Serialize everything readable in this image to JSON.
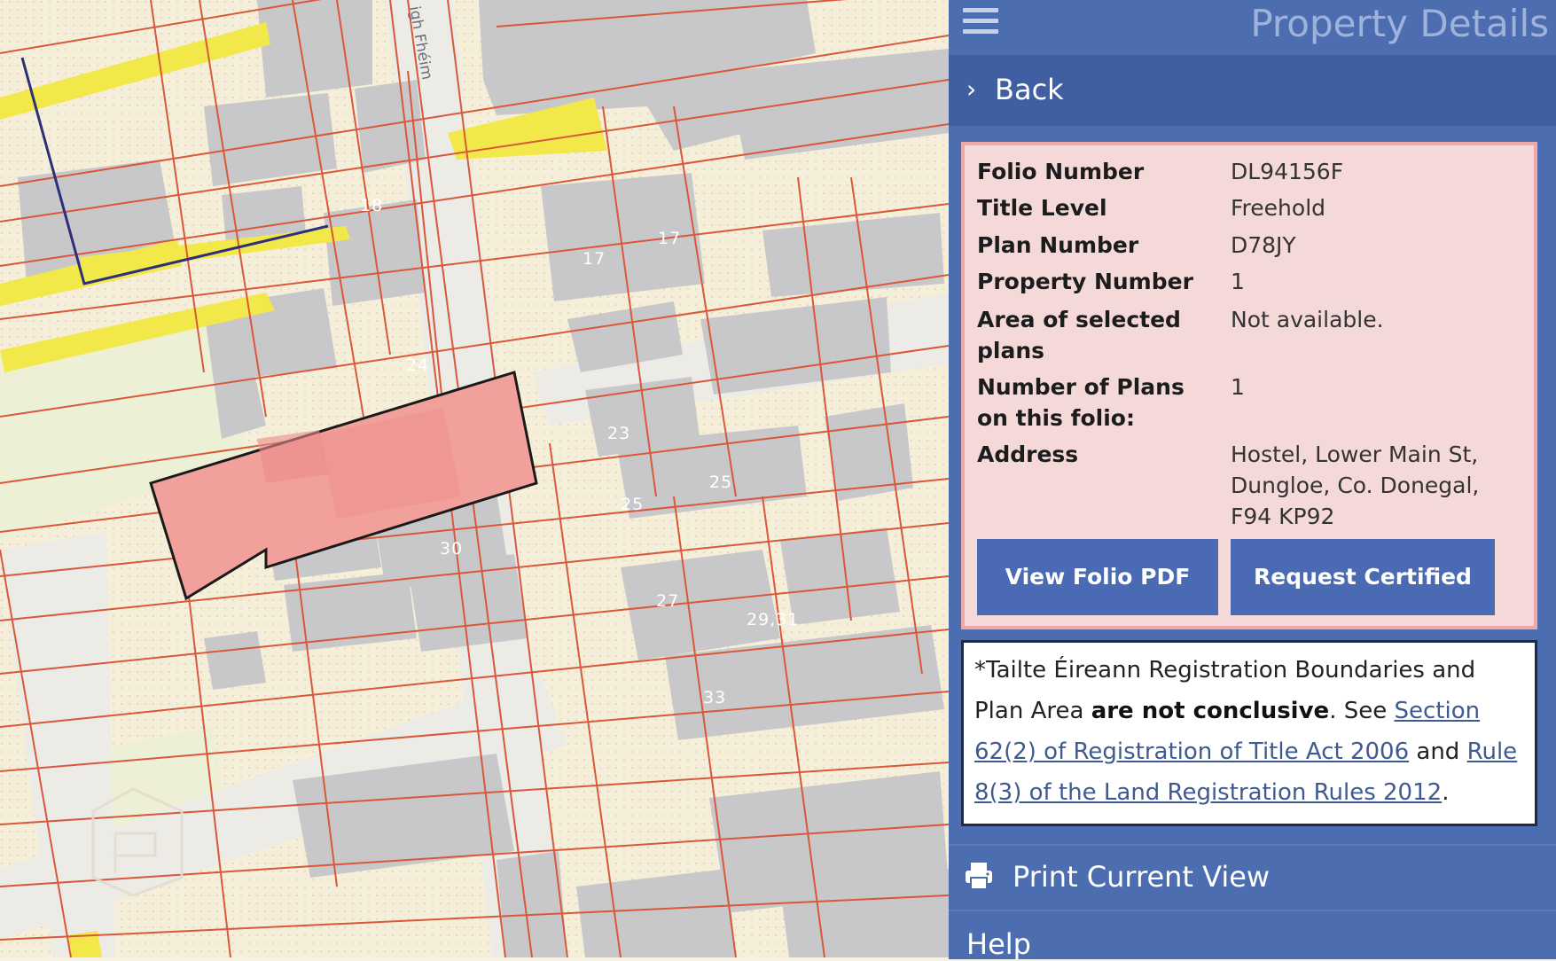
{
  "map": {
    "street_name": "igh Fhéim",
    "lot_numbers": [
      "18",
      "17",
      "17",
      "24",
      "23",
      "25",
      "25",
      "30",
      "27",
      "29,31",
      "33"
    ],
    "colors": {
      "background": "#f5efd9",
      "building": "#c9c9cb",
      "road": "#eeedea",
      "parcel_boundary": "#d9583c",
      "highlight_road": "#f3e84a",
      "selected_parcel": "#f2a09b",
      "selected_outline": "#1a1a1a",
      "route_line": "#2c2f7a"
    }
  },
  "panel": {
    "title": "Property Details",
    "back_label": "Back",
    "fields": [
      {
        "label": "Folio Number",
        "value": "DL94156F"
      },
      {
        "label": "Title Level",
        "value": "Freehold"
      },
      {
        "label": "Plan Number",
        "value": "D78JY"
      },
      {
        "label": "Property Number",
        "value": "1"
      },
      {
        "label": "Area of selected plans",
        "value": "Not available."
      },
      {
        "label": "Number of Plans on this folio:",
        "value": "1"
      },
      {
        "label": "Address",
        "value": "Hostel, Lower Main St, Dungloe, Co. Donegal, F94 KP92"
      }
    ],
    "view_pdf_label": "View Folio PDF",
    "certified_copy_label": "Request Certified Copy",
    "notice": {
      "prefix": "*Tailte Éireann Registration Boundaries and Plan Area ",
      "bold": "are not conclusive",
      "middle": ". See ",
      "link1": "Section 62(2) of Registration of Title Act 2006",
      "and": " and ",
      "link2": "Rule 8(3) of the Land Registration Rules 2012",
      "suffix": "."
    },
    "print_label": "Print Current View",
    "help_label": "Help",
    "colors": {
      "panel": "#4d6db1",
      "back_bar": "#3f5fa2",
      "details_bg": "#f4d9d8",
      "details_border": "#f0a8a6",
      "button": "#4a6ab3",
      "link": "#3f5a8f"
    }
  }
}
